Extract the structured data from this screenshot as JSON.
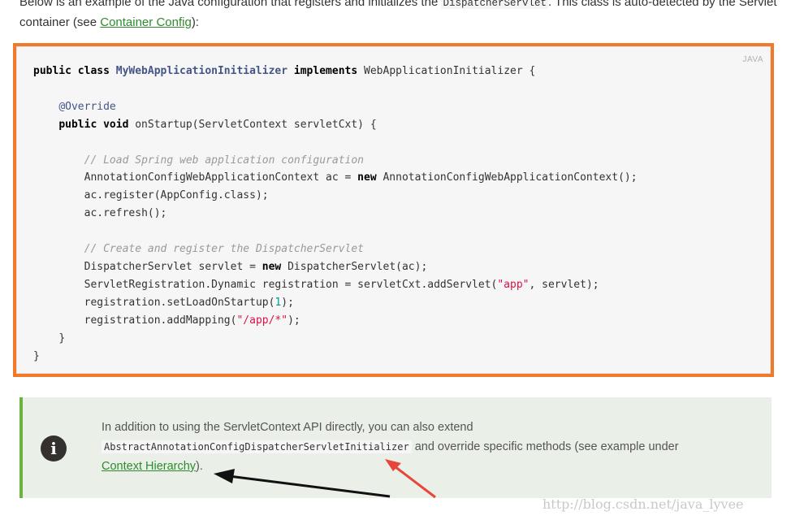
{
  "intro": {
    "before": "Below is an example of the Java configuration that registers and initializes the ",
    "code": "DispatcherServlet",
    "after": ". This class is auto-detected by the Servlet container (see ",
    "link": "Container Config",
    "end": "):"
  },
  "code_block": {
    "language": "JAVA",
    "class_kw": "public class",
    "class_name": "MyWebApplicationInitializer",
    "implements_kw": "implements",
    "interface": "WebApplicationInitializer {",
    "annotation": "@Override",
    "method_kw": "public void",
    "method_sig": "onStartup(ServletContext servletCxt) {",
    "comment1": "// Load Spring web application configuration",
    "line_ac_a": "AnnotationConfigWebApplicationContext ac = ",
    "line_ac_new": "new",
    "line_ac_b": " AnnotationConfigWebApplicationContext();",
    "line_register": "ac.register(AppConfig.class);",
    "line_refresh": "ac.refresh();",
    "comment2": "// Create and register the DispatcherServlet",
    "line_servlet_a": "DispatcherServlet servlet = ",
    "line_servlet_new": "new",
    "line_servlet_b": " DispatcherServlet(ac);",
    "line_reg_a": "ServletRegistration.Dynamic registration = servletCxt.addServlet(",
    "line_reg_str": "\"app\"",
    "line_reg_b": ", servlet);",
    "line_load_a": "registration.setLoadOnStartup(",
    "line_load_num": "1",
    "line_load_b": ");",
    "line_map_a": "registration.addMapping(",
    "line_map_str": "\"/app/*\"",
    "line_map_b": ");",
    "close_method": "}",
    "close_class": "}"
  },
  "note": {
    "icon": "info-icon",
    "icon_glyph": "i",
    "line1": "In addition to using the ServletContext API directly, you can also extend",
    "code": "AbstractAnnotationConfigDispatcherServletInitializer",
    "middle": " and override specific methods (see example under ",
    "link": "Context Hierarchy",
    "end": ")."
  },
  "watermark": "http://blog.csdn.net/java_lyvee",
  "colors": {
    "highlight_border": "#f07a2a",
    "note_accent": "#6db33f",
    "link": "#2f8a2f",
    "red_arrow": "#e8453c",
    "black_arrow": "#111111"
  }
}
